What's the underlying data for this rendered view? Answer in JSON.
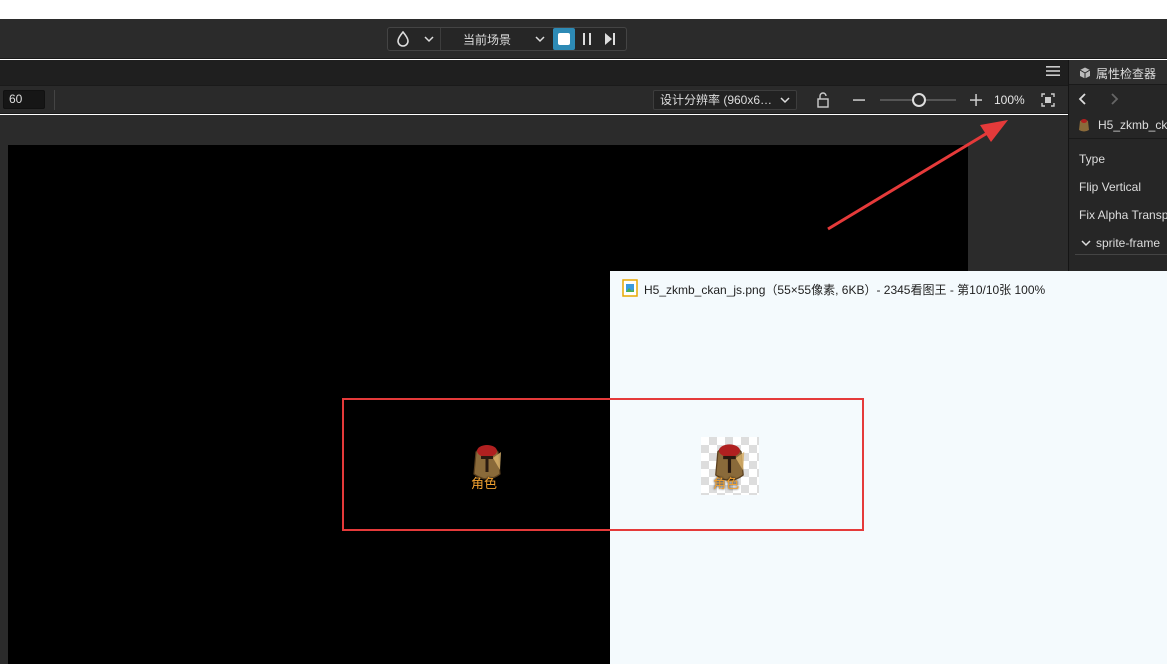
{
  "toolbar": {
    "scene_select_label": "当前场景",
    "icons": [
      "drop-icon",
      "chevron-down-icon",
      "stop-icon",
      "pause-icon",
      "step-icon"
    ]
  },
  "scene_toolbar": {
    "fps_value": "60",
    "resolution_label": "设计分辨率 (960x6…",
    "zoom_label": "100%",
    "zoom_level_percent": 100
  },
  "inspector": {
    "title": "属性检查器",
    "node_name": "H5_zkmb_ck",
    "properties": [
      "Type",
      "Flip Vertical",
      "Fix Alpha Transp"
    ],
    "section_label": "sprite-frame"
  },
  "image_viewer": {
    "title": "H5_zkmb_ckan_js.png（55×55像素, 6KB）- 2345看图王 - 第10/10张 100%"
  },
  "sprite": {
    "caption": "角色"
  },
  "colors": {
    "annotation_red": "#e53a3a",
    "accent_blue": "#2d8ab5",
    "canvas_black": "#000000"
  }
}
